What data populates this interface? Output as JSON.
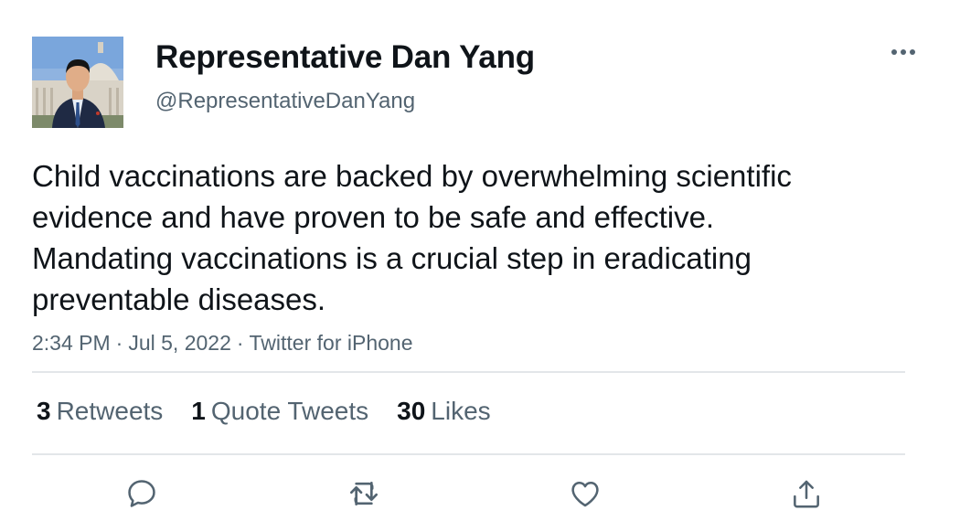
{
  "author": {
    "display_name": "Representative Dan Yang",
    "handle": "@RepresentativeDanYang"
  },
  "tweet": {
    "text": "Child vaccinations are backed by overwhelming scientific evidence and have proven to be safe and effective. Mandating vaccinations is a crucial step in eradicating preventable diseases.",
    "time": "2:34 PM",
    "date": "Jul 5, 2022",
    "source": "Twitter for iPhone",
    "separator": "·"
  },
  "stats": {
    "retweets": {
      "count": "3",
      "label": "Retweets"
    },
    "quotes": {
      "count": "1",
      "label": "Quote Tweets"
    },
    "likes": {
      "count": "30",
      "label": "Likes"
    }
  },
  "icons": {
    "more": "more-horizontal-icon",
    "reply": "reply-icon",
    "retweet": "retweet-icon",
    "like": "heart-icon",
    "share": "share-icon"
  },
  "colors": {
    "text_primary": "#0f1419",
    "text_secondary": "#536471",
    "divider": "#e3e6e9"
  }
}
